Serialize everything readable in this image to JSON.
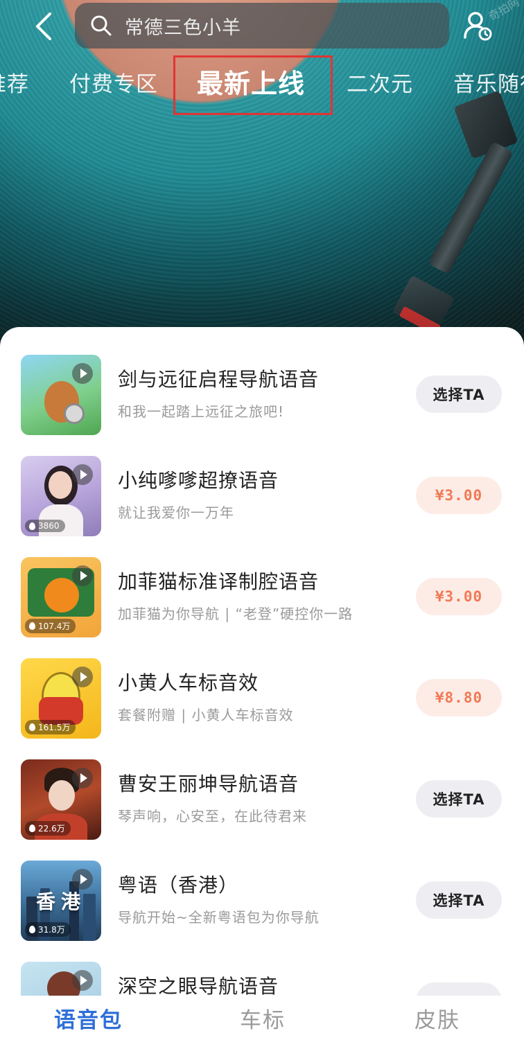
{
  "search": {
    "query": "常德三色小羊"
  },
  "watermark": "奇拍网",
  "tabs": [
    {
      "label": "推荐"
    },
    {
      "label": "付费专区"
    },
    {
      "label": "最新上线"
    },
    {
      "label": "二次元"
    },
    {
      "label": "音乐随行"
    }
  ],
  "active_tab": "最新上线",
  "items": [
    {
      "title": "剑与远征启程导航语音",
      "subtitle": "和我一起踏上远征之旅吧!",
      "action": "选择TA",
      "action_type": "select",
      "plays": ""
    },
    {
      "title": "小纯嗲嗲超撩语音",
      "subtitle": "就让我爱你一万年",
      "action": "¥3.00",
      "action_type": "price",
      "plays": "3860"
    },
    {
      "title": "加菲猫标准译制腔语音",
      "subtitle": "加菲猫为你导航 | “老登”硬控你一路",
      "action": "¥3.00",
      "action_type": "price",
      "plays": "107.4万"
    },
    {
      "title": "小黄人车标音效",
      "subtitle": "套餐附赠 | 小黄人车标音效",
      "action": "¥8.80",
      "action_type": "price",
      "plays": "161.5万"
    },
    {
      "title": "曹安王丽坤导航语音",
      "subtitle": "琴声响，心安至，在此待君来",
      "action": "选择TA",
      "action_type": "select",
      "plays": "22.6万"
    },
    {
      "title": "粤语（香港）",
      "subtitle": "导航开始~全新粤语包为你导航",
      "action": "选择TA",
      "action_type": "select",
      "plays": "31.8万",
      "thumb_text": "香港"
    },
    {
      "title": "深空之眼导航语音",
      "subtitle": "",
      "action": "",
      "action_type": "select",
      "plays": ""
    }
  ],
  "bottom_nav": [
    {
      "label": "语音包"
    },
    {
      "label": "车标"
    },
    {
      "label": "皮肤"
    }
  ],
  "colors": {
    "accent": "#2f6fd8",
    "price_text": "#f07a55",
    "price_bg": "#fdece6",
    "select_bg": "#eeeef2",
    "highlight_box": "#e23434"
  }
}
